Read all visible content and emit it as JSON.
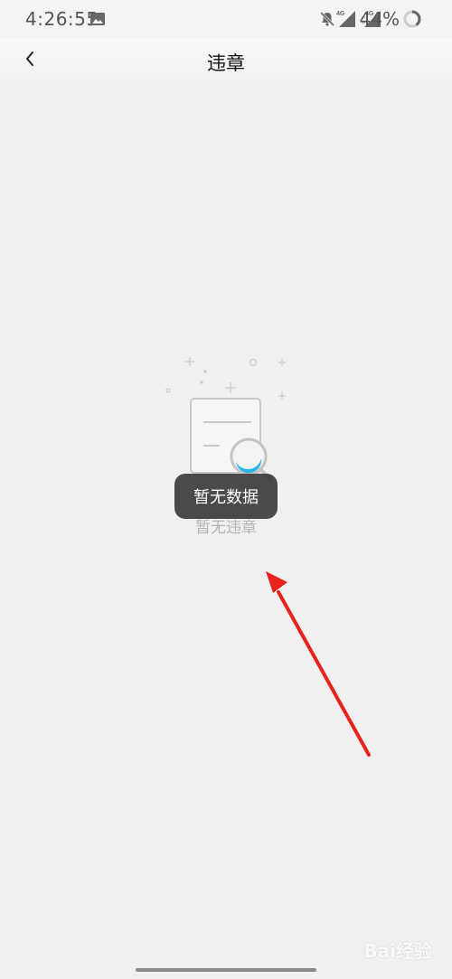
{
  "status_bar": {
    "time": "4:26:55",
    "battery_percent": "44%",
    "icons": [
      "gallery-icon",
      "mute-bell-icon",
      "signal-4g-icon",
      "signal-4g-icon",
      "battery-ring-icon"
    ]
  },
  "nav": {
    "title": "违章",
    "back_icon": "chevron-left-icon"
  },
  "empty_state": {
    "text": "暂无违章",
    "illustration": "document-search-icon",
    "accent_color": "#27b3ee"
  },
  "toast": {
    "text": "暂无数据"
  },
  "annotation": {
    "arrow_color": "#e8231d"
  },
  "watermark": {
    "text": "Bai经验"
  }
}
